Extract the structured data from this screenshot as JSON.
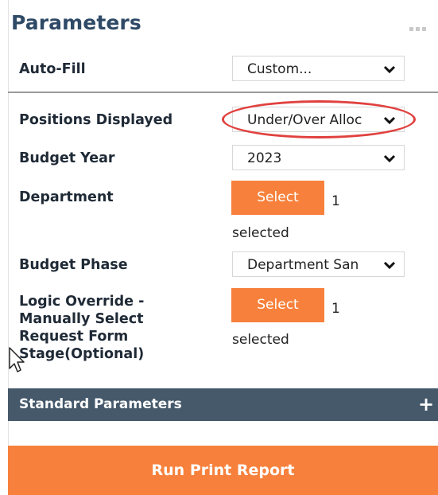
{
  "title": "Parameters",
  "fields": {
    "autofill": {
      "label": "Auto-Fill",
      "value": "Custom..."
    },
    "positions": {
      "label": "Positions Displayed",
      "value": "Under/Over Alloc"
    },
    "budget_year": {
      "label": "Budget Year",
      "value": "2023"
    },
    "department": {
      "label": "Department",
      "button": "Select",
      "count": "1",
      "selected_text": "selected"
    },
    "budget_phase": {
      "label": "Budget Phase",
      "value": "Department San"
    },
    "logic_override": {
      "label_lines": [
        "Logic Override -",
        "Manually Select",
        "Request Form",
        "Stage(Optional)"
      ],
      "button": "Select",
      "count": "1",
      "selected_text": "selected"
    }
  },
  "sections": {
    "standard_parameters": "Standard Parameters",
    "expand_icon": "plus-icon"
  },
  "actions": {
    "run_label": "Run Print Report"
  },
  "colors": {
    "accent": "#f7813c",
    "header_bar": "#45596b",
    "title": "#2f4a66",
    "highlight": "#e0413f"
  }
}
